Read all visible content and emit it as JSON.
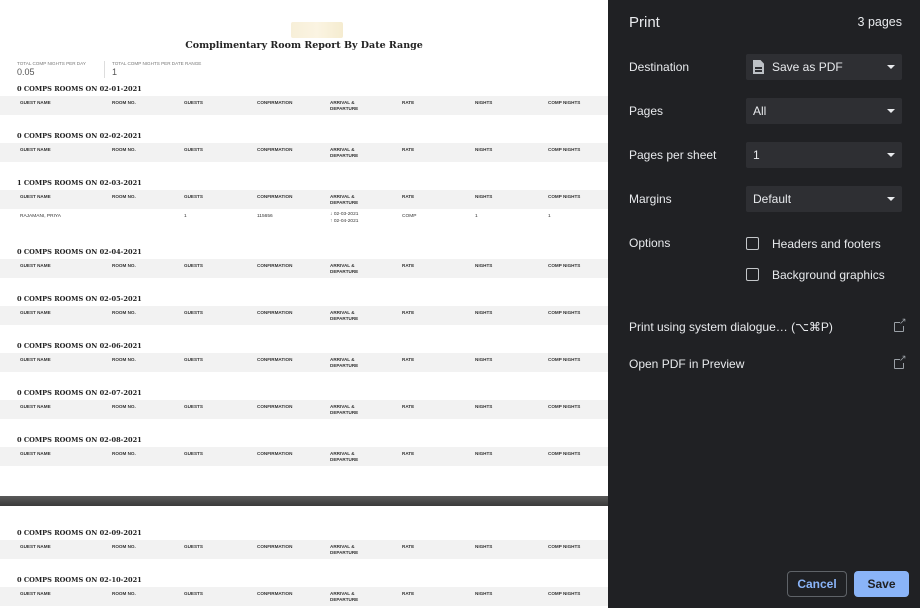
{
  "report": {
    "title": "Complimentary Room Report By Date Range",
    "stats": [
      {
        "label": "Total Comp Nights Per Day",
        "value": "0.05"
      },
      {
        "label": "Total Comp Nights Per Date Range",
        "value": "1"
      }
    ],
    "columns": [
      "Guest Name",
      "Room No.",
      "Guests",
      "Confirmation",
      "Arrival & Departure",
      "Rate",
      "Nights",
      "Comp Nights"
    ],
    "page1_sections": [
      {
        "title": "0 COMPS ROOMS ON 02-01-2021",
        "rows": []
      },
      {
        "title": "0 COMPS ROOMS ON 02-02-2021",
        "rows": []
      },
      {
        "title": "1 COMPS ROOMS ON 02-03-2021",
        "rows": [
          {
            "guest_name": "RAJAMANI, PRIYA",
            "room_no": "",
            "guests": "1",
            "confirmation": "115656",
            "arrival": "02-03-2021",
            "departure": "02-04-2021",
            "rate": "COMP",
            "nights": "1",
            "comp_nights": "1"
          }
        ]
      },
      {
        "title": "0 COMPS ROOMS ON 02-04-2021",
        "rows": []
      },
      {
        "title": "0 COMPS ROOMS ON 02-05-2021",
        "rows": []
      },
      {
        "title": "0 COMPS ROOMS ON 02-06-2021",
        "rows": []
      },
      {
        "title": "0 COMPS ROOMS ON 02-07-2021",
        "rows": []
      },
      {
        "title": "0 COMPS ROOMS ON 02-08-2021",
        "rows": []
      }
    ],
    "page2_sections": [
      {
        "title": "0 COMPS ROOMS ON 02-09-2021",
        "rows": []
      },
      {
        "title": "0 COMPS ROOMS ON 02-10-2021",
        "rows": []
      }
    ]
  },
  "print_panel": {
    "title": "Print",
    "page_count": "3 pages",
    "destination": {
      "label": "Destination",
      "value": "Save as PDF",
      "icon": "file-icon"
    },
    "pages": {
      "label": "Pages",
      "value": "All"
    },
    "pages_per_sheet": {
      "label": "Pages per sheet",
      "value": "1"
    },
    "margins": {
      "label": "Margins",
      "value": "Default"
    },
    "options": {
      "label": "Options",
      "headers_footers": {
        "label": "Headers and footers",
        "checked": false
      },
      "background_graphics": {
        "label": "Background graphics",
        "checked": false
      }
    },
    "system_dialog_link": "Print using system dialogue… (⌥⌘P)",
    "open_pdf_link": "Open PDF in Preview",
    "cancel_label": "Cancel",
    "save_label": "Save"
  },
  "colors": {
    "accent": "#8ab4f8",
    "panel_bg": "#202124",
    "select_bg": "#2e2f33"
  }
}
